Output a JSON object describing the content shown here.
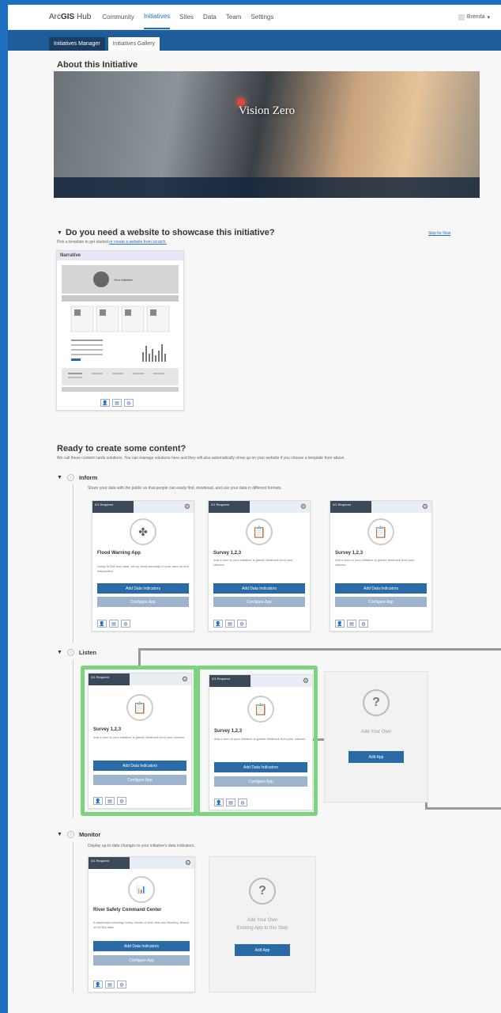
{
  "nav": {
    "brand_pre": "Arc",
    "brand_bold": "GIS",
    "brand_post": " Hub",
    "items": [
      "Community",
      "Initiatives",
      "Sites",
      "Data",
      "Team",
      "Settings"
    ],
    "active": "Initiatives",
    "user": "Brenda"
  },
  "subtabs": [
    "Initiatives Manager",
    "Initiatives Gallery"
  ],
  "about": {
    "heading": "About this Initiative",
    "hero_title": "Vision Zero"
  },
  "website": {
    "heading": "Do you need a website to showcase this initiative?",
    "pick_text": "Pick a template to get started",
    "or_link": "or create a website from scratch.",
    "skip": "Skip for Now",
    "template_name": "Narrative",
    "template_banner": "Your Initiative"
  },
  "content": {
    "heading": "Ready to create some content?",
    "desc": "We call these content cards solutions. You can manage solutions here and they will also automatically show up on your website if you choose a template from above."
  },
  "steps": {
    "inform": {
      "name": "Inform",
      "desc": "Share your data with the public so that people can easily find, download, and use your data in different formats.",
      "cards": [
        {
          "req": "0/1 Required",
          "title": "Flood Warning App",
          "desc": "Using NOAA river data, set up flood warnings in your area for first responders."
        },
        {
          "req": "0/1 Required",
          "title": "Survey 1,2,3",
          "desc": "Add a form to your initiative to gather feedback from your citizens."
        },
        {
          "req": "0/1 Required",
          "title": "Survey 1,2,3",
          "desc": "Add a form to your initiative to gather feedback from your citizens."
        }
      ]
    },
    "listen": {
      "name": "Listen",
      "cards": [
        {
          "req": "0/1 Required",
          "title": "Survey 1,2,3",
          "desc": "Add a form to your initiative to gather feedback from your citizens."
        },
        {
          "req": "0/1 Required",
          "title": "Survey 1,2,3",
          "desc": "Add a form to your initiative to gather feedback from your citizens."
        }
      ],
      "add_own": {
        "line1": "Add Your Own",
        "button": "Add App"
      }
    },
    "monitor": {
      "name": "Monitor",
      "desc": "Display up-to-date changes to your initiative's data indicators.",
      "cards": [
        {
          "req": "0/1 Required",
          "title": "River Safety Command Center",
          "desc": "A dashboard showing hourly results of river flow and flooding. Based on NOAA data."
        }
      ],
      "add_own": {
        "line1": "Add Your Own",
        "line2": "Existing App to this Step",
        "button": "Add App"
      }
    }
  },
  "buttons": {
    "add_indicators": "Add Data Indicators",
    "configure": "Configure App"
  }
}
